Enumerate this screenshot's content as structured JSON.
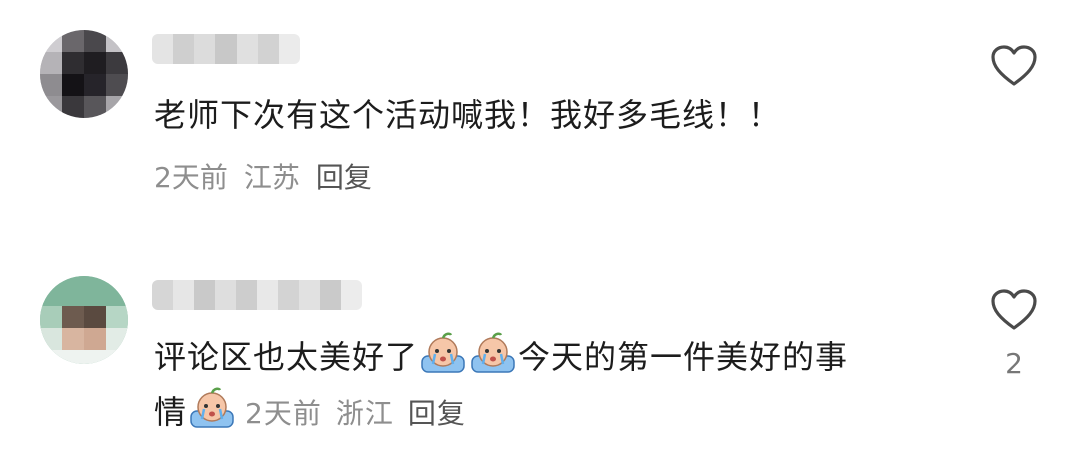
{
  "comments": [
    {
      "text": "老师下次有这个活动喊我！我好多毛线！！",
      "time": "2天前",
      "location": "江苏",
      "reply_label": "回复",
      "like_icon": "heart-outline-icon"
    },
    {
      "text_line1": "评论区也太美好了",
      "text_mid": "今天的第一件美好的事",
      "text_line2": "情",
      "emoji_name": "crying-face-emoji",
      "time": "2天前",
      "location": "浙江",
      "reply_label": "回复",
      "like_icon": "heart-outline-icon",
      "like_count": "2"
    }
  ],
  "colors": {
    "text": "#1c1c1c",
    "meta": "#8e8e8e",
    "reply": "#555555",
    "heart_stroke": "#4a4a4a"
  }
}
